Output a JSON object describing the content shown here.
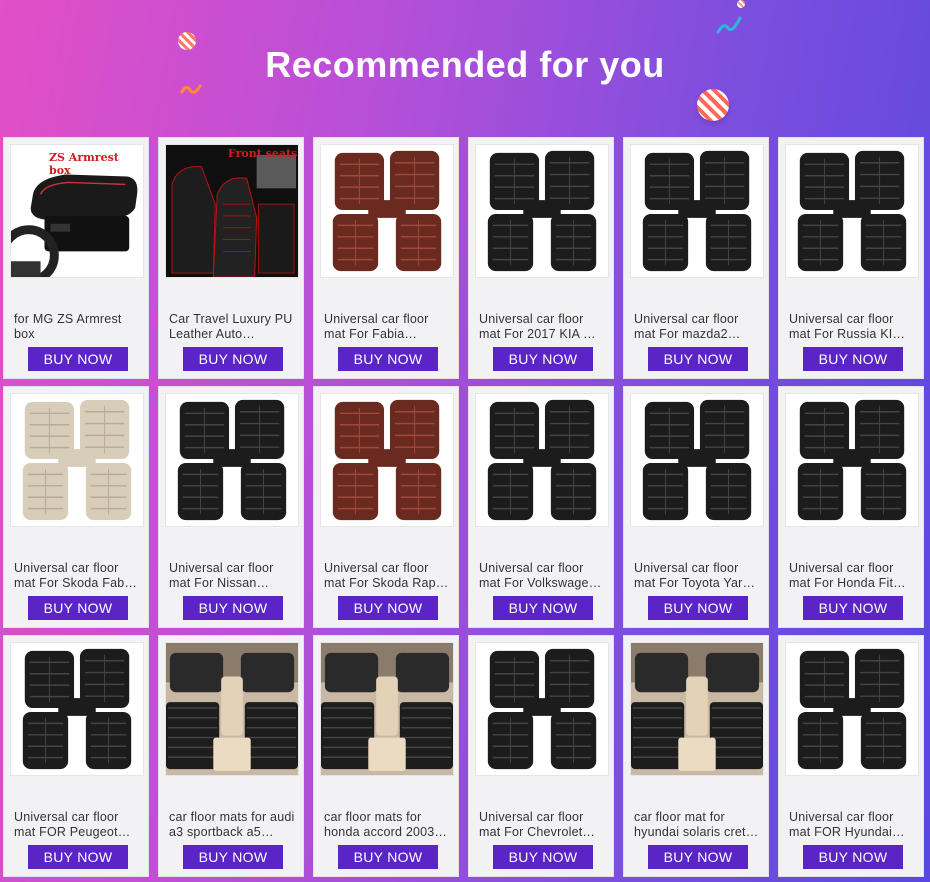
{
  "header": {
    "title": "Recommended for you"
  },
  "colors": {
    "button": "#5a24c7",
    "card": "#f2f2f4",
    "gradient_start": "#e24fc6",
    "gradient_end": "#5848df"
  },
  "products": [
    {
      "name": "for MG ZS Armrest box",
      "button": "BUY NOW",
      "image": "armrest-box",
      "overlay": "ZS Armrest box"
    },
    {
      "name": "Car Travel Luxury PU Leather Auto…",
      "button": "BUY NOW",
      "image": "seat-cover",
      "overlay": "Front seats"
    },
    {
      "name": "Universal car floor mat For Fabia…",
      "button": "BUY NOW",
      "image": "floor-mat-brown"
    },
    {
      "name": "Universal car floor mat For 2017 KIA …",
      "button": "BUY NOW",
      "image": "floor-mat-black"
    },
    {
      "name": "Universal car floor mat For mazda2…",
      "button": "BUY NOW",
      "image": "floor-mat-black"
    },
    {
      "name": "Universal car floor mat For Russia KI…",
      "button": "BUY NOW",
      "image": "floor-mat-black"
    },
    {
      "name": "Universal car floor mat For Skoda Fab…",
      "button": "BUY NOW",
      "image": "floor-mat-beige"
    },
    {
      "name": "Universal car floor mat For Nissan…",
      "button": "BUY NOW",
      "image": "floor-mat-black"
    },
    {
      "name": "Universal car floor mat For Skoda Rap…",
      "button": "BUY NOW",
      "image": "floor-mat-brown"
    },
    {
      "name": "Universal car floor mat For Volkswage…",
      "button": "BUY NOW",
      "image": "floor-mat-black"
    },
    {
      "name": "Universal car floor mat For Toyota Yar…",
      "button": "BUY NOW",
      "image": "floor-mat-black"
    },
    {
      "name": "Universal car floor mat For Honda Fit…",
      "button": "BUY NOW",
      "image": "floor-mat-black"
    },
    {
      "name": "Universal car floor mat FOR Peugeot…",
      "button": "BUY NOW",
      "image": "floor-mat-black"
    },
    {
      "name": "car floor mats for audi a3 sportback a5…",
      "button": "BUY NOW",
      "image": "car-interior"
    },
    {
      "name": "car floor mats for honda accord 2003…",
      "button": "BUY NOW",
      "image": "car-interior"
    },
    {
      "name": "Universal car floor mat For Chevrolet…",
      "button": "BUY NOW",
      "image": "floor-mat-black"
    },
    {
      "name": "car floor mat for hyundai solaris cret…",
      "button": "BUY NOW",
      "image": "car-interior"
    },
    {
      "name": "Universal car floor mat FOR Hyundai…",
      "button": "BUY NOW",
      "image": "floor-mat-black"
    }
  ]
}
